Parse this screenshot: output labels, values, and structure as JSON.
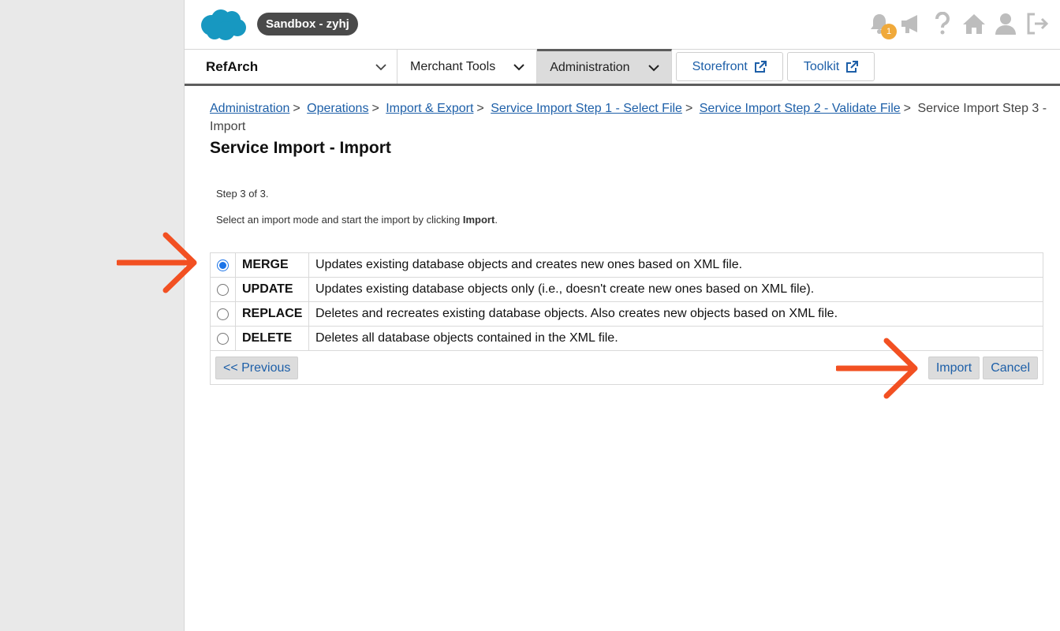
{
  "header": {
    "sandbox_label": "Sandbox - zyhj",
    "notification_count": "1"
  },
  "nav": {
    "site_name": "RefArch",
    "merchant_tools": "Merchant Tools",
    "administration": "Administration",
    "storefront": "Storefront",
    "toolkit": "Toolkit"
  },
  "breadcrumb": {
    "items": [
      "Administration",
      "Operations",
      "Import & Export",
      "Service Import Step 1 - Select File",
      "Service Import Step 2 - Validate File"
    ],
    "current": "Service Import Step 3 - Import",
    "separator": ">"
  },
  "page": {
    "title": "Service Import - Import",
    "step_text": "Step 3 of 3.",
    "instruction_prefix": "Select an import mode and start the import by clicking ",
    "instruction_bold": "Import",
    "instruction_suffix": "."
  },
  "modes": [
    {
      "label": "MERGE",
      "description": "Updates existing database objects and creates new ones based on XML file.",
      "selected": true
    },
    {
      "label": "UPDATE",
      "description": "Updates existing database objects only (i.e., doesn't create new ones based on XML file).",
      "selected": false
    },
    {
      "label": "REPLACE",
      "description": "Deletes and recreates existing database objects. Also creates new objects based on XML file.",
      "selected": false
    },
    {
      "label": "DELETE",
      "description": "Deletes all database objects contained in the XML file.",
      "selected": false
    }
  ],
  "buttons": {
    "previous": "<< Previous",
    "import": "Import",
    "cancel": "Cancel"
  },
  "colors": {
    "accent_link": "#1d5fa8",
    "annotation_arrow": "#f25022",
    "badge": "#f0a93a",
    "cloud": "#1798c1"
  },
  "icons": [
    "salesforce-cloud-logo",
    "bell-icon",
    "megaphone-icon",
    "help-icon",
    "home-icon",
    "user-icon",
    "logout-icon",
    "external-link-icon",
    "chevron-down-icon"
  ]
}
